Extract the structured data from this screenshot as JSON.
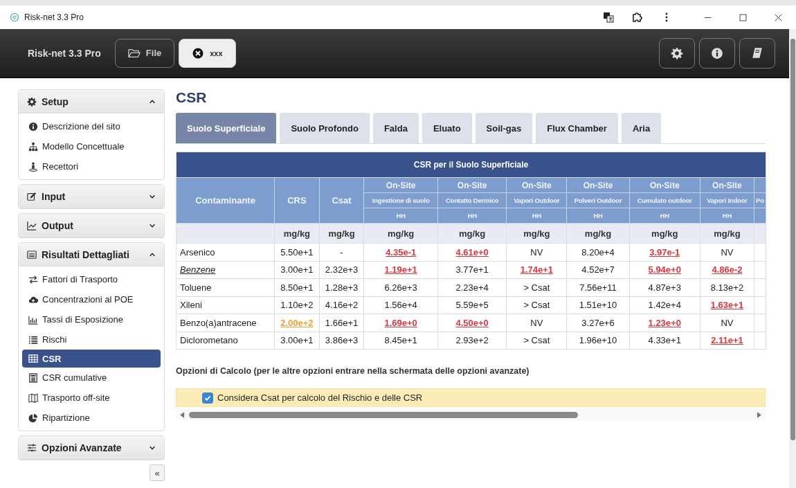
{
  "window": {
    "title": "Risk-net 3.3 Pro"
  },
  "toolbar": {
    "app_name": "Risk-net 3.3 Pro",
    "buttons": [
      {
        "kind": "file",
        "label": "File",
        "selected": false
      },
      {
        "kind": "close",
        "label": "xxx",
        "selected": true
      }
    ]
  },
  "sidebar": {
    "sections": [
      {
        "kind": "gear",
        "label": "Setup",
        "expanded": true,
        "items": [
          {
            "kind": "info",
            "label": "Descrizione del sito",
            "selected": false
          },
          {
            "kind": "sitemap",
            "label": "Modello Concettuale",
            "selected": false
          },
          {
            "kind": "person",
            "label": "Recettori",
            "selected": false
          }
        ]
      },
      {
        "kind": "edit",
        "label": "Input",
        "expanded": false
      },
      {
        "kind": "chart",
        "label": "Output",
        "expanded": false
      },
      {
        "kind": "listalt",
        "label": "Risultati Dettagliati",
        "expanded": true,
        "items": [
          {
            "kind": "exchange",
            "label": "Fattori di Trasporto",
            "selected": false
          },
          {
            "kind": "cloud",
            "label": "Concentrazioni al POE",
            "selected": false
          },
          {
            "kind": "bars",
            "label": "Tassi di Esposizione",
            "selected": false
          },
          {
            "kind": "list",
            "label": "Rischi",
            "selected": false
          },
          {
            "kind": "table",
            "label": "CSR",
            "selected": true
          },
          {
            "kind": "calc",
            "label": "CSR cumulative",
            "selected": false
          },
          {
            "kind": "map",
            "label": "Trasporto off-site",
            "selected": false
          },
          {
            "kind": "pie",
            "label": "Ripartizione",
            "selected": false
          }
        ]
      },
      {
        "kind": "sliders",
        "label": "Opzioni Avanzate",
        "expanded": false
      }
    ],
    "collapse_button": "«"
  },
  "page_title": "CSR",
  "tabs": [
    {
      "label": "Suolo Superficiale",
      "selected": true
    },
    {
      "label": "Suolo Profondo",
      "selected": false
    },
    {
      "label": "Falda",
      "selected": false
    },
    {
      "label": "Eluato",
      "selected": false
    },
    {
      "label": "Soil-gas",
      "selected": false
    },
    {
      "label": "Flux Chamber",
      "selected": false
    },
    {
      "label": "Aria",
      "selected": false
    }
  ],
  "table": {
    "title": "CSR per il Suolo Superficiale",
    "columns": [
      {
        "label": "Contaminante"
      },
      {
        "label": "CRS",
        "unit": "mg/kg"
      },
      {
        "label": "Csat",
        "unit": "mg/kg"
      },
      {
        "group": "On-Site",
        "label": "Ingestione di suolo",
        "receptor": "HH",
        "unit": "mg/kg"
      },
      {
        "group": "On-Site",
        "label": "Contatto Dermico",
        "receptor": "HH",
        "unit": "mg/kg"
      },
      {
        "group": "On-Site",
        "label": "Vapori Outdoor",
        "receptor": "HH",
        "unit": "mg/kg"
      },
      {
        "group": "On-Site",
        "label": "Polveri Outdoor",
        "receptor": "HH",
        "unit": "mg/kg"
      },
      {
        "group": "On-Site",
        "label": "Cumulato outdoor",
        "receptor": "HH",
        "unit": "mg/kg"
      },
      {
        "group": "On-Site",
        "label": "Vapori Indoor",
        "receptor": "HH",
        "unit": "mg/kg"
      },
      {
        "label": "Po"
      }
    ],
    "rows": [
      {
        "cells": [
          "Arsenico",
          "5.50e+1",
          "-",
          {
            "text": "4.35e-1",
            "color": "#d9363e"
          },
          {
            "text": "4.61e+0",
            "color": "#d9363e"
          },
          "NV",
          "8.20e+4",
          {
            "text": "3.97e-1",
            "color": "#d9363e"
          },
          "NV"
        ]
      },
      {
        "cells": [
          {
            "text": "Benzene",
            "kind": "link"
          },
          "3.00e+1",
          "2.32e+3",
          {
            "text": "1.19e+1",
            "color": "#d9363e"
          },
          "3.77e+1",
          {
            "text": "1.74e+1",
            "color": "#d9363e"
          },
          "4.52e+7",
          {
            "text": "5.94e+0",
            "color": "#d9363e"
          },
          {
            "text": "4.86e-2",
            "color": "#d9363e"
          }
        ]
      },
      {
        "cells": [
          "Toluene",
          "8.50e+1",
          "1.28e+3",
          "6.26e+3",
          "2.23e+4",
          "> Csat",
          "7.56e+11",
          "4.87e+3",
          "8.13e+2"
        ]
      },
      {
        "cells": [
          "Xileni",
          "1.10e+2",
          "4.16e+2",
          "1.56e+4",
          "5.59e+5",
          "> Csat",
          "1.51e+10",
          "1.42e+4",
          {
            "text": "1.63e+1",
            "color": "#d9363e"
          }
        ]
      },
      {
        "cells": [
          "Benzo(a)antracene",
          {
            "text": "2.00e+2",
            "color": "#f0a030"
          },
          "1.66e+1",
          {
            "text": "1.69e+0",
            "color": "#d9363e"
          },
          {
            "text": "4.50e+0",
            "color": "#d9363e"
          },
          "NV",
          "3.27e+6",
          {
            "text": "1.23e+0",
            "color": "#d9363e"
          },
          "NV"
        ]
      },
      {
        "cells": [
          "Diclorometano",
          "3.00e+1",
          "3.86e+3",
          "8.45e+1",
          "2.93e+2",
          "> Csat",
          "1.96e+10",
          "4.33e+1",
          {
            "text": "2.11e+1",
            "color": "#d9363e"
          }
        ]
      }
    ]
  },
  "options": {
    "title": "Opzioni di Calcolo (per le altre opzioni entrare nella schermata delle opzioni avanzate)",
    "items": [
      {
        "label": "Considera Csat per calcolo del Rischio e delle CSR",
        "checked": true
      }
    ]
  }
}
